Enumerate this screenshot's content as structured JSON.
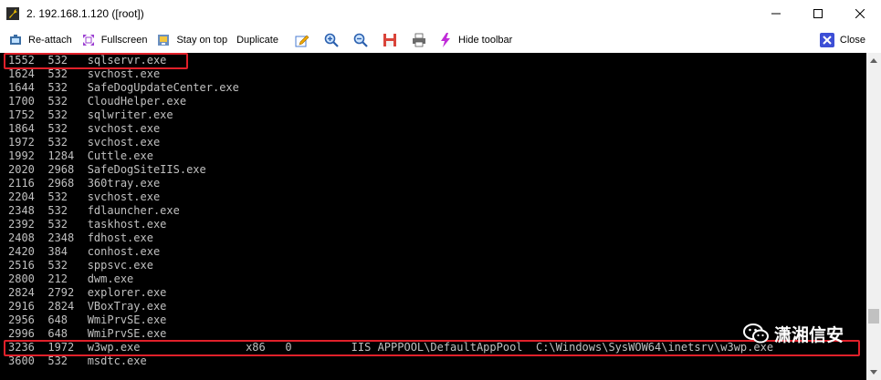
{
  "window": {
    "title": "2. 192.168.1.120 ([root])",
    "icon": "wrench-icon"
  },
  "toolbar": {
    "reattach_label": "Re-attach",
    "fullscreen_label": "Fullscreen",
    "stay_on_top_label": "Stay on top",
    "duplicate_label": "Duplicate",
    "hide_toolbar_label": "Hide toolbar",
    "close_label": "Close",
    "icons": [
      "pencil-icon",
      "zoom-in-icon",
      "zoom-out-icon",
      "save-icon",
      "print-icon"
    ]
  },
  "terminal": {
    "lines": [
      "1552  532   sqlservr.exe",
      "1624  532   svchost.exe",
      "1644  532   SafeDogUpdateCenter.exe",
      "1700  532   CloudHelper.exe",
      "1752  532   sqlwriter.exe",
      "1864  532   svchost.exe",
      "1972  532   svchost.exe",
      "1992  1284  Cuttle.exe",
      "2020  2968  SafeDogSiteIIS.exe",
      "2116  2968  360tray.exe",
      "2204  532   svchost.exe",
      "2348  532   fdlauncher.exe",
      "2392  532   taskhost.exe",
      "2408  2348  fdhost.exe",
      "2420  384   conhost.exe",
      "2516  532   sppsvc.exe",
      "2800  212   dwm.exe",
      "2824  2792  explorer.exe",
      "2916  2824  VBoxTray.exe",
      "2956  648   WmiPrvSE.exe",
      "2996  648   WmiPrvSE.exe",
      "3236  1972  w3wp.exe                x86   0         IIS APPPOOL\\DefaultAppPool  C:\\Windows\\SysWOW64\\inetsrv\\w3wp.exe",
      "3600  532   msdtc.exe"
    ]
  },
  "watermark": {
    "text": "潇湘信安",
    "icon": "wechat-icon"
  },
  "colors": {
    "terminal_bg": "#000000",
    "terminal_fg": "#c0c0c0",
    "highlight": "#e0202a"
  }
}
